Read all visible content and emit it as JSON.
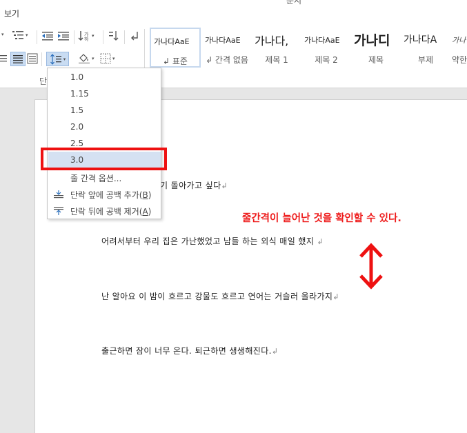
{
  "menu": {
    "view": "보기"
  },
  "title_fragment": "문서",
  "ribbon": {
    "group_label": "단락",
    "styles": [
      {
        "preview": "가나다AaE",
        "name": "↲ 표준",
        "selected": true
      },
      {
        "preview": "가나다AaE",
        "name": "↲ 간격 없음",
        "selected": false
      },
      {
        "preview": "가나다,",
        "name": "제목 1",
        "selected": false
      },
      {
        "preview": "가나다AaE",
        "name": "제목 2",
        "selected": false
      },
      {
        "preview": "가나디",
        "name": "제목",
        "selected": false
      },
      {
        "preview": "가나다A",
        "name": "부제",
        "selected": false
      },
      {
        "preview": "가나",
        "name": "약한",
        "selected": false
      }
    ]
  },
  "line_spacing_menu": {
    "options": [
      "1.0",
      "1.15",
      "1.5",
      "2.0",
      "2.5",
      "3.0"
    ],
    "selected": "3.0",
    "line_spacing_options": "줄 간격 옵션...",
    "add_space_before": "단락 앞에 공백 추가",
    "add_space_before_key": "B",
    "remove_space_after": "단락 뒤에 공백 제거",
    "remove_space_after_key": "A"
  },
  "document": {
    "lines": [
      "기 돌아가고 싶다",
      "어려서부터 우리 집은 가난했었고 남들 하는 외식 매일 했지",
      "난 알아요 이 밤이 흐르고 강물도 흐르고 연어는 거슬러 올라가지",
      "출근하면 잠이 너무 온다. 퇴근하면 생생해진다."
    ],
    "paragraph_mark": "↲"
  },
  "annotation": {
    "text": "줄간격이 늘어난 것을 확인할 수 있다.",
    "color": "#ee1c1c"
  },
  "colors": {
    "highlight_box": "#ee1111",
    "menu_highlight": "#d5e1f2",
    "arrow": "#ee1111"
  }
}
